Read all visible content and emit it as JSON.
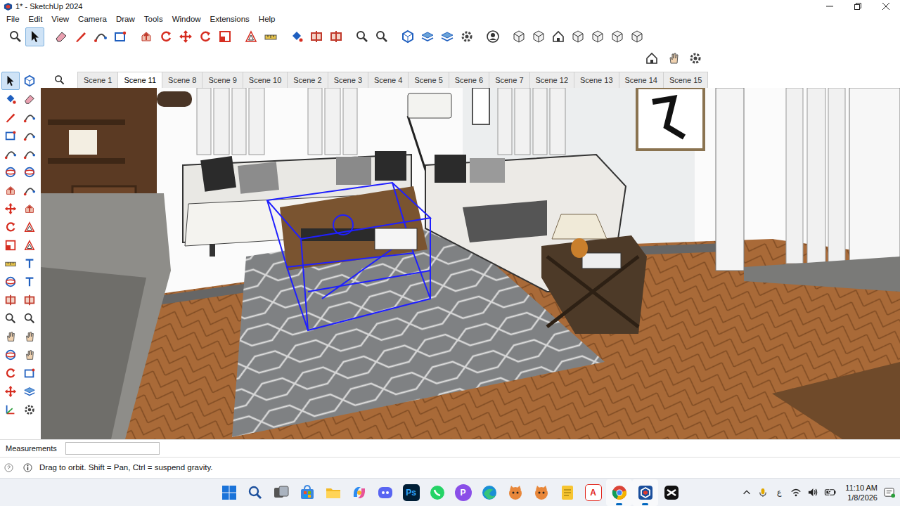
{
  "window": {
    "title": "1* - SketchUp 2024"
  },
  "menu": [
    "File",
    "Edit",
    "View",
    "Camera",
    "Draw",
    "Tools",
    "Window",
    "Extensions",
    "Help"
  ],
  "main_toolbar": [
    {
      "selected": false
    },
    {
      "selected": true
    },
    {
      "selected": false
    },
    {
      "selected": false
    },
    {
      "selected": false
    },
    {
      "selected": false
    },
    {
      "selected": false
    },
    {
      "selected": false
    },
    {
      "selected": false
    },
    {
      "selected": false
    },
    {
      "selected": false
    },
    {
      "selected": false
    },
    {
      "selected": false
    },
    {
      "selected": false
    },
    {
      "selected": false
    },
    {
      "selected": false
    },
    {
      "selected": false
    },
    {
      "selected": false
    },
    {
      "selected": false
    },
    {
      "selected": false
    },
    {
      "selected": false
    },
    {
      "selected": false
    },
    {
      "selected": false
    },
    {
      "selected": false
    },
    {
      "selected": false
    },
    {
      "selected": false
    },
    {
      "selected": false
    },
    {
      "selected": false
    },
    {
      "selected": false
    },
    {
      "selected": false
    }
  ],
  "right_toolbar": [
    {
      "selected": false
    },
    {
      "selected": false
    },
    {
      "selected": false
    }
  ],
  "left_toolbar": [
    {
      "selected": true
    },
    {
      "selected": false
    },
    {
      "selected": false
    },
    {
      "selected": false
    },
    {
      "selected": false
    },
    {
      "selected": false
    },
    {
      "selected": false
    },
    {
      "selected": false
    },
    {
      "selected": false
    },
    {
      "selected": false
    },
    {
      "selected": false
    },
    {
      "selected": false
    },
    {
      "selected": false
    },
    {
      "selected": false
    },
    {
      "selected": false
    },
    {
      "selected": false
    },
    {
      "selected": false
    },
    {
      "selected": false
    },
    {
      "selected": false
    },
    {
      "selected": false
    },
    {
      "selected": false
    },
    {
      "selected": false
    },
    {
      "selected": false
    },
    {
      "selected": false
    },
    {
      "selected": false
    },
    {
      "selected": false
    },
    {
      "selected": false
    },
    {
      "selected": false
    },
    {
      "selected": false
    },
    {
      "selected": false
    },
    {
      "selected": false
    },
    {
      "selected": false
    },
    {
      "selected": false
    },
    {
      "selected": false
    },
    {
      "selected": false
    },
    {
      "selected": false
    },
    {
      "selected": false
    },
    {
      "selected": false
    }
  ],
  "scenes": [
    {
      "label": "Scene 1",
      "selected": false
    },
    {
      "label": "Scene 11",
      "selected": true
    },
    {
      "label": "Scene 8",
      "selected": false
    },
    {
      "label": "Scene 9",
      "selected": false
    },
    {
      "label": "Scene 10",
      "selected": false
    },
    {
      "label": "Scene 2",
      "selected": false
    },
    {
      "label": "Scene 3",
      "selected": false
    },
    {
      "label": "Scene 4",
      "selected": false
    },
    {
      "label": "Scene 5",
      "selected": false
    },
    {
      "label": "Scene 6",
      "selected": false
    },
    {
      "label": "Scene 7",
      "selected": false
    },
    {
      "label": "Scene 12",
      "selected": false
    },
    {
      "label": "Scene 13",
      "selected": false
    },
    {
      "label": "Scene 14",
      "selected": false
    },
    {
      "label": "Scene 15",
      "selected": false
    }
  ],
  "measurements": {
    "label": "Measurements",
    "value": ""
  },
  "status_bar": {
    "hint": "Drag to orbit. Shift = Pan, Ctrl = suspend gravity."
  },
  "taskbar": {
    "apps": [
      {
        "kind": "start",
        "running": false
      },
      {
        "kind": "search",
        "running": false
      },
      {
        "kind": "taskview",
        "running": false
      },
      {
        "kind": "store",
        "running": false
      },
      {
        "kind": "explorer",
        "running": false
      },
      {
        "kind": "copilot",
        "running": false
      },
      {
        "kind": "discord",
        "running": false
      },
      {
        "kind": "photoshop",
        "glyph": "Ps",
        "running": false
      },
      {
        "kind": "whatsapp",
        "running": false
      },
      {
        "kind": "proton",
        "glyph": "P",
        "running": false
      },
      {
        "kind": "edge",
        "running": false
      },
      {
        "kind": "mascot",
        "running": false
      },
      {
        "kind": "mascot",
        "running": false
      },
      {
        "kind": "notes",
        "running": false
      },
      {
        "kind": "acrobat",
        "glyph": "A",
        "running": false
      },
      {
        "kind": "chrome",
        "running": true
      },
      {
        "kind": "sketchup",
        "running": true
      },
      {
        "kind": "capcut",
        "running": false
      }
    ],
    "tray": {
      "language": "ع",
      "time": "11:10 AM",
      "date": "1/8/2026"
    }
  }
}
